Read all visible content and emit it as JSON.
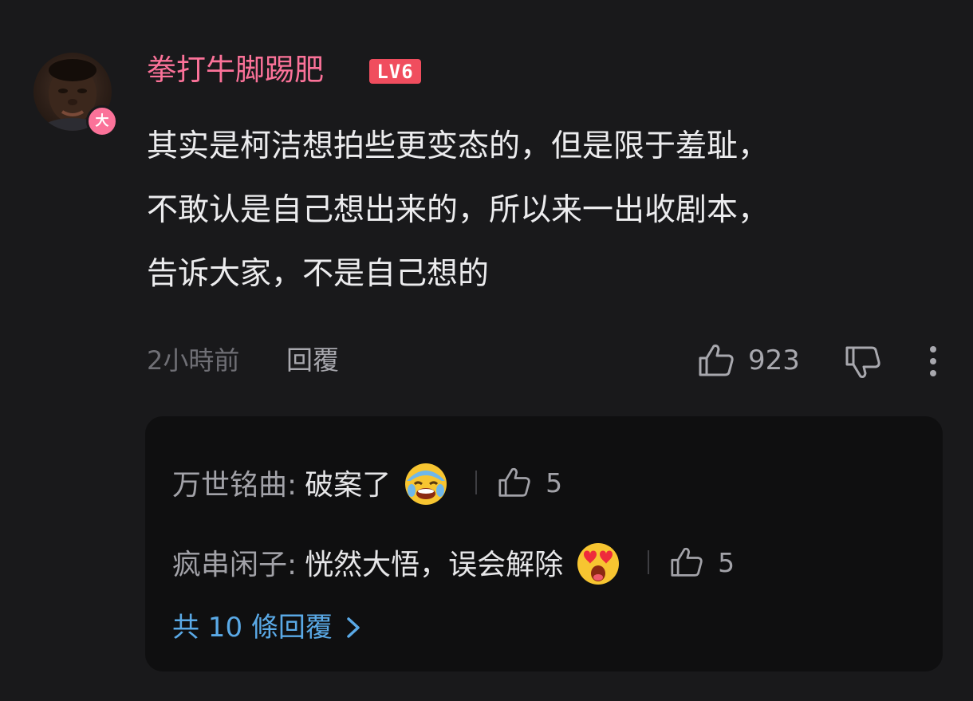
{
  "comment": {
    "username": "拳打牛脚踢肥",
    "level_badge": "LV6",
    "avatar_badge": "大",
    "content_lines": [
      "其实是柯洁想拍些更变态的，但是限于羞耻，",
      "不敢认是自己想出来的，所以来一出收剧本，",
      "告诉大家，不是自己想的"
    ],
    "time": "2小時前",
    "reply_label": "回覆",
    "like_count": "923",
    "colors": {
      "username": "#fb7299",
      "level_badge": "#f04d5e",
      "link": "#5aa9e6"
    }
  },
  "replies": [
    {
      "author": "万世铭曲:",
      "text": "破案了",
      "emoji": "laughing-crying-emoji",
      "likes": "5"
    },
    {
      "author": "疯串闲子:",
      "text": "恍然大悟，误会解除",
      "emoji": "heart-eyes-emoji",
      "likes": "5"
    }
  ],
  "view_all_replies": "共 10 條回覆"
}
